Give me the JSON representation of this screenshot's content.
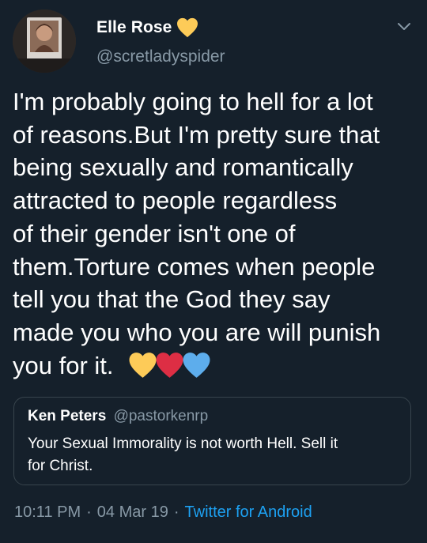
{
  "author": {
    "display_name": "Elle Rose",
    "handle": "@scretladyspider",
    "badge_icon": "yellow-heart-icon",
    "avatar_icon": "profile-photo-avatar"
  },
  "tweet": {
    "text": "I'm probably going to hell for a lot\nof reasons.But I'm pretty sure that\nbeing sexually and romantically\nattracted to people regardless\nof their gender isn't one of\nthem.Torture comes when people\ntell you that the God they say\nmade you who you are will punish\nyou for it.",
    "emoji": [
      "yellow-heart-icon",
      "red-heart-icon",
      "blue-heart-icon"
    ]
  },
  "quoted_tweet": {
    "display_name": "Ken Peters",
    "handle": "@pastorkenrp",
    "text": "Your Sexual Immorality is not worth Hell. Sell it\nfor Christ."
  },
  "meta": {
    "time": "10:11 PM",
    "date": "04 Mar 19",
    "separator": "·",
    "source": "Twitter for Android"
  },
  "colors": {
    "background": "#15202b",
    "text": "#ffffff",
    "secondary": "#8899a6",
    "accent": "#1da1f2",
    "yellow_heart": "#fdcb58",
    "red_heart": "#dd2e44",
    "blue_heart": "#5dadec"
  }
}
